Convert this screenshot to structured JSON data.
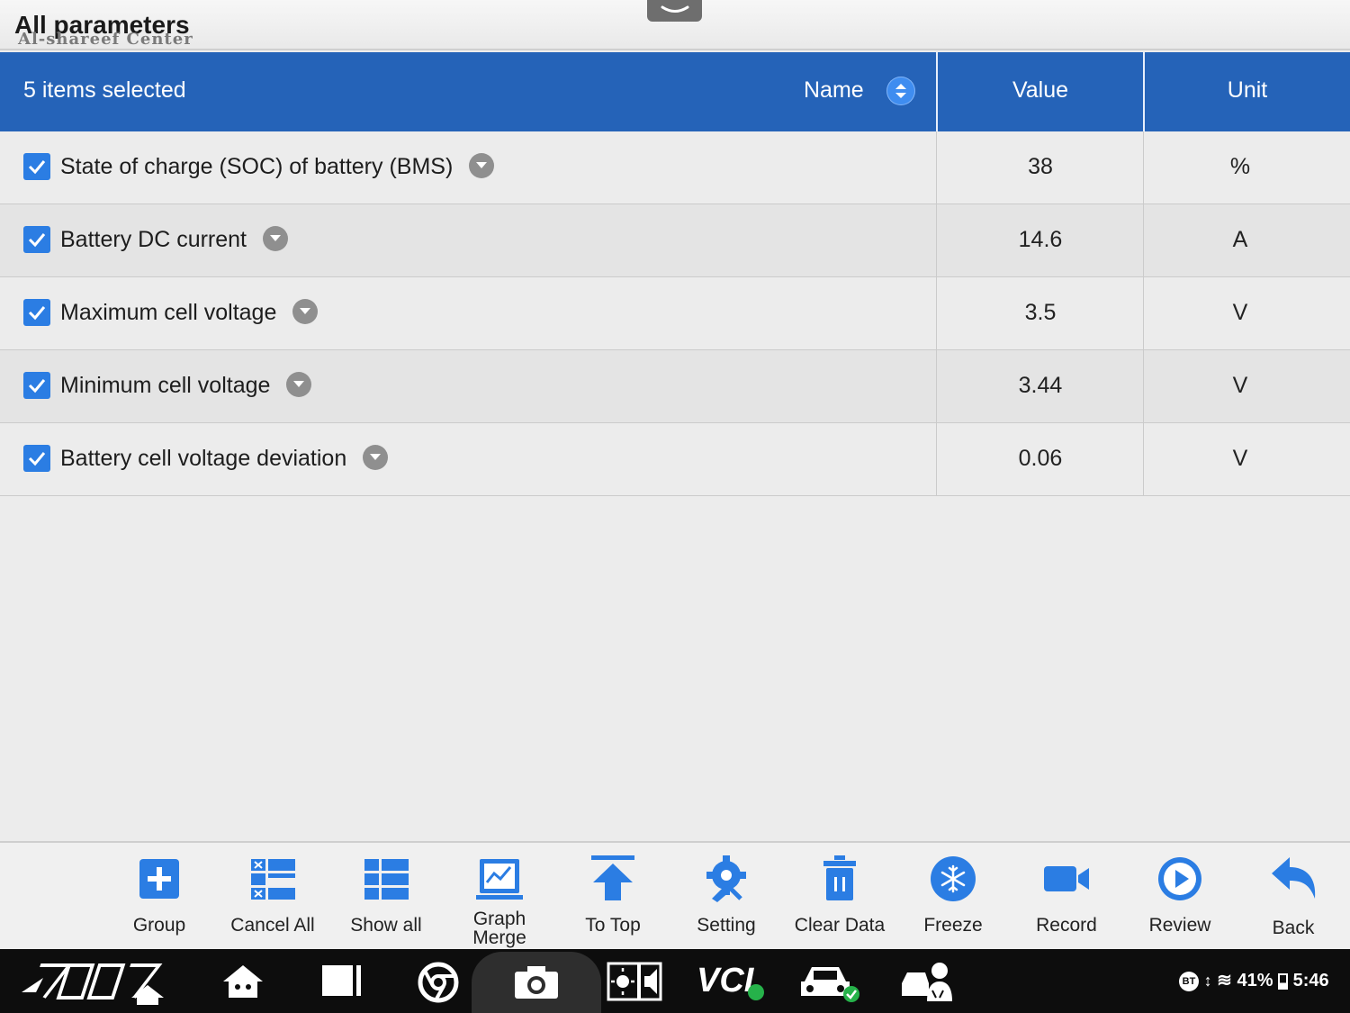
{
  "header": {
    "title": "All parameters",
    "watermark": "Al-shareef Center"
  },
  "table": {
    "selected_text": "5 items selected",
    "col_name": "Name",
    "col_value": "Value",
    "col_unit": "Unit",
    "rows": [
      {
        "name": "State of charge (SOC) of battery (BMS)",
        "value": "38",
        "unit": "%",
        "checked": true
      },
      {
        "name": "Battery DC current",
        "value": "14.6",
        "unit": "A",
        "checked": true
      },
      {
        "name": "Maximum cell voltage",
        "value": "3.5",
        "unit": "V",
        "checked": true
      },
      {
        "name": "Minimum cell voltage",
        "value": "3.44",
        "unit": "V",
        "checked": true
      },
      {
        "name": "Battery cell voltage deviation",
        "value": "0.06",
        "unit": "V",
        "checked": true
      }
    ]
  },
  "toolbar": {
    "group": "Group",
    "cancel_all": "Cancel All",
    "show_all": "Show all",
    "graph_merge_1": "Graph",
    "graph_merge_2": "Merge",
    "to_top": "To Top",
    "setting": "Setting",
    "clear_data": "Clear Data",
    "freeze": "Freeze",
    "record": "Record",
    "review": "Review",
    "back": "Back"
  },
  "system_bar": {
    "battery": "41%",
    "time": "5:46",
    "bt": "BT",
    "vci": "VCI"
  },
  "colors": {
    "header_blue": "#2563b8",
    "icon_blue": "#2b7de3",
    "checkbox_blue": "#2b7de3"
  }
}
